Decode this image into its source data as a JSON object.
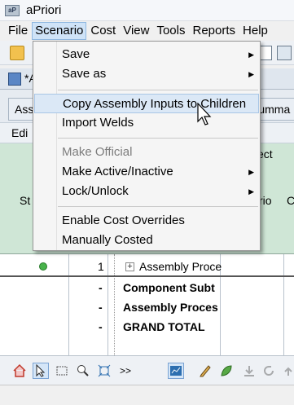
{
  "window": {
    "title": "aPriori"
  },
  "menubar": {
    "items": [
      {
        "label": "File"
      },
      {
        "label": "Scenario",
        "active": true
      },
      {
        "label": "Cost"
      },
      {
        "label": "View"
      },
      {
        "label": "Tools"
      },
      {
        "label": "Reports"
      },
      {
        "label": "Help"
      }
    ]
  },
  "tab": {
    "label": "*A"
  },
  "subtabs": {
    "left": "Ass",
    "right": "Summa"
  },
  "edit_bar": {
    "label": "Edi"
  },
  "grid_header": {
    "top_right": "ect",
    "col_status": "St",
    "col_scenario": "rio",
    "col_edge": "C"
  },
  "rows": [
    {
      "qty": "1",
      "name": "Assembly Proce",
      "status": "green"
    },
    {
      "qty": "-",
      "name": "Component Subt",
      "bold": true
    },
    {
      "qty": "-",
      "name": "Assembly Proces",
      "bold": true
    },
    {
      "qty": "-",
      "name": "GRAND TOTAL",
      "bold": true
    }
  ],
  "bottom_toolbar": {
    "more": ">>"
  },
  "scenario_menu": {
    "items": [
      {
        "label": "Save",
        "submenu": true
      },
      {
        "label": "Save as",
        "submenu": true
      },
      {
        "label": "Copy Assembly Inputs to Children",
        "hover": true
      },
      {
        "label": "Import Welds"
      },
      {
        "label": "Make Official",
        "disabled": true
      },
      {
        "label": "Make Active/Inactive",
        "submenu": true
      },
      {
        "label": "Lock/Unlock",
        "submenu": true
      },
      {
        "label": "Enable Cost Overrides"
      },
      {
        "label": "Manually Costed"
      }
    ]
  },
  "colors": {
    "accent": "#dbe8f6",
    "grid_header": "#cfe6d6",
    "status_ok": "#48b24a"
  }
}
